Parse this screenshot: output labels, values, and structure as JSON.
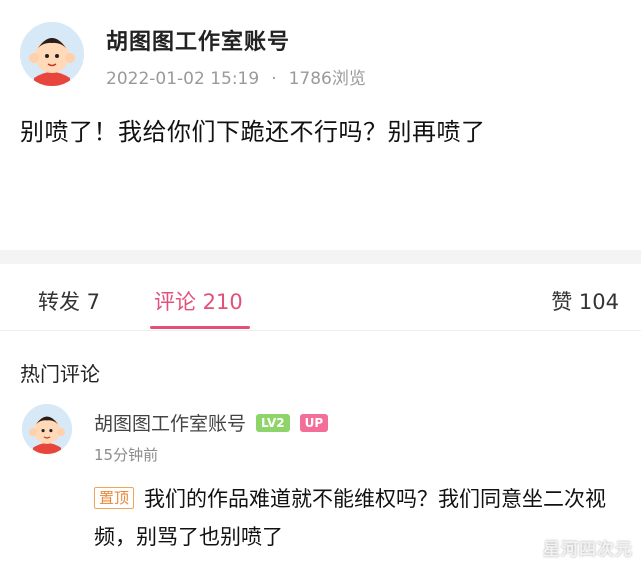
{
  "post": {
    "author": "胡图图工作室账号",
    "date": "2022-01-02 15:19",
    "separator": "·",
    "views": "1786浏览",
    "body": "别喷了！我给你们下跪还不行吗？别再喷了"
  },
  "tabs": {
    "repost": "转发 7",
    "comments": "评论 210",
    "likes": "赞 104"
  },
  "comments_section": {
    "heading": "热门评论",
    "items": [
      {
        "author": "胡图图工作室账号",
        "level_badge": "LV2",
        "up_badge": "UP",
        "time": "15分钟前",
        "pin_tag": "置顶",
        "text": "我们的作品难道就不能维权吗？我们同意坐二次视频，别骂了也别喷了"
      }
    ]
  },
  "watermark": "星河四次元",
  "colors": {
    "accent": "#e4507a",
    "pin_tag": "#e8893a",
    "level_badge": "#8ed46a",
    "up_badge": "#f36e98"
  },
  "icons": {
    "post_avatar": "cartoon-boy-avatar-icon",
    "comment_avatar": "cartoon-boy-avatar-icon"
  }
}
